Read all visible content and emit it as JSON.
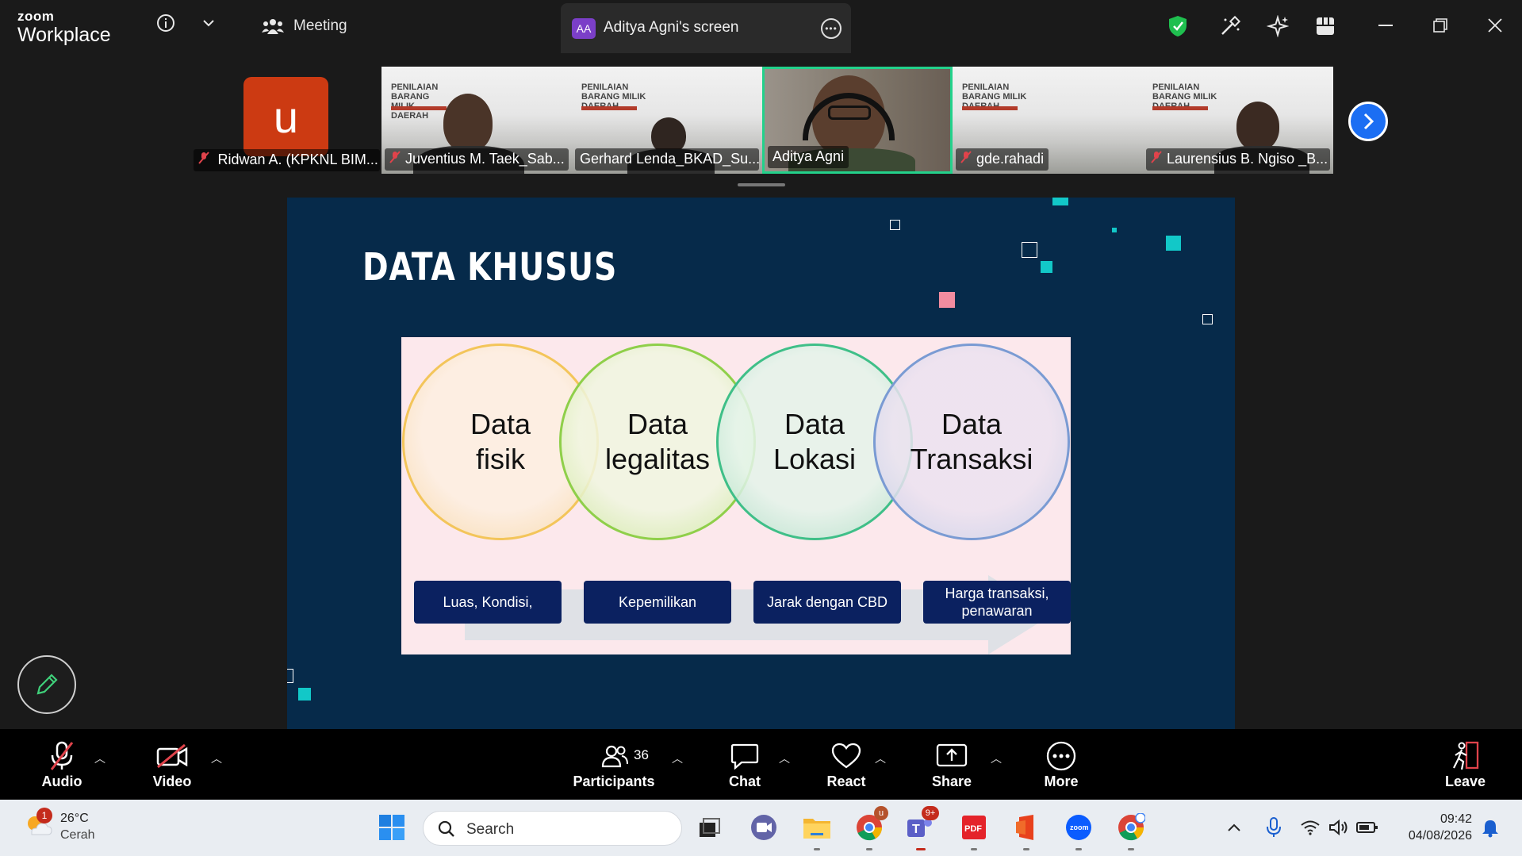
{
  "app": {
    "brand_top": "zoom",
    "brand_bottom": "Workplace"
  },
  "header": {
    "meeting_label": "Meeting",
    "tab_badge": "AA",
    "tab_title": "Aditya Agni's screen"
  },
  "gallery": {
    "avatar_letter": "u",
    "participants": [
      {
        "name": "Ridwan A. (KPKNL BIM...",
        "muted": true,
        "video": false
      },
      {
        "name": "Juventius M. Taek_Sab...",
        "muted": true,
        "video": true
      },
      {
        "name": "Gerhard Lenda_BKAD_Su...",
        "muted": false,
        "video": true
      },
      {
        "name": "Aditya Agni",
        "muted": false,
        "video": true,
        "active_speaker": true
      },
      {
        "name": "gde.rahadi",
        "muted": true,
        "video": true
      },
      {
        "name": "Laurensius B. Ngiso _B...",
        "muted": true,
        "video": true
      }
    ],
    "slide_thumb_text": "PENILAIAN BARANG MILIK DAERAH"
  },
  "slide": {
    "title": "DATA KHUSUS",
    "circles": [
      {
        "line1": "Data",
        "line2": "fisik",
        "color": "#f3c55a"
      },
      {
        "line1": "Data",
        "line2": "legalitas",
        "color": "#8fcf4a"
      },
      {
        "line1": "Data",
        "line2": "Lokasi",
        "color": "#3fbf88"
      },
      {
        "line1": "Data",
        "line2": "Transaksi",
        "color": "#7a9bd3"
      }
    ],
    "tags": [
      {
        "line1": "Luas, Kondisi,",
        "line2": ""
      },
      {
        "line1": "Kepemilikan",
        "line2": ""
      },
      {
        "line1": "Jarak dengan CBD",
        "line2": ""
      },
      {
        "line1": "Harga transaksi,",
        "line2": "penawaran"
      }
    ],
    "accent_color": "#12c8c8",
    "background_color": "#062a4a"
  },
  "controls": {
    "audio": "Audio",
    "video": "Video",
    "participants": "Participants",
    "participant_count": "36",
    "chat": "Chat",
    "react": "React",
    "share": "Share",
    "more": "More",
    "leave": "Leave"
  },
  "taskbar": {
    "weather_temp": "26°C",
    "weather_desc": "Cerah",
    "weather_badge": "1",
    "search_placeholder": "Search",
    "teams_badge": "9+",
    "chrome_badge": "u",
    "time": "09:42",
    "date": "04/08/2026"
  }
}
